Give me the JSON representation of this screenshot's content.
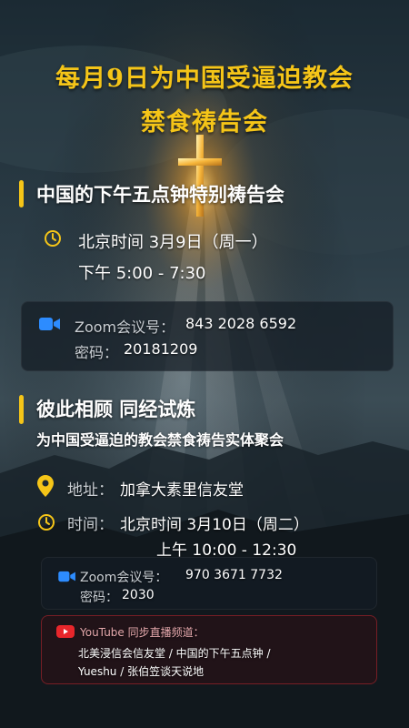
{
  "title": {
    "line1": "每月9日为中国受逼迫教会",
    "line2": "禁食祷告会"
  },
  "section1": {
    "heading": "中国的下午五点钟特别祷告会",
    "time_line1": "北京时间 3月9日（周一）",
    "time_line2": "下午 5:00 - 7:30",
    "zoom_label": "Zoom会议号：",
    "zoom_id": "843 2028 6592",
    "password_label": "密码：",
    "password": "20181209"
  },
  "section2": {
    "heading": "彼此相顾 同经试炼",
    "subheading": "为中国受逼迫的教会禁食祷告实体聚会",
    "address_label": "地址：",
    "address": "加拿大素里信友堂",
    "time_label": "时间：",
    "time_line1": "北京时间 3月10日（周二）",
    "time_line2": "上午 10:00 - 12:30",
    "zoom_label": "Zoom会议号：",
    "zoom_id": "970 3671 7732",
    "password_label": "密码：",
    "password": "2030",
    "youtube_label": "YouTube 同步直播频道：",
    "youtube_line1": "北美浸信会信友堂 / 中国的下午五点钟 /",
    "youtube_line2": "Yueshu / 张伯笠谈天说地"
  },
  "icons": {
    "clock": "clock-icon",
    "video": "video-camera-icon",
    "pin": "map-pin-icon",
    "youtube": "youtube-icon"
  },
  "colors": {
    "accent": "#f5c518",
    "zoom_blue": "#2d8cff",
    "youtube_red": "#e8262b"
  }
}
